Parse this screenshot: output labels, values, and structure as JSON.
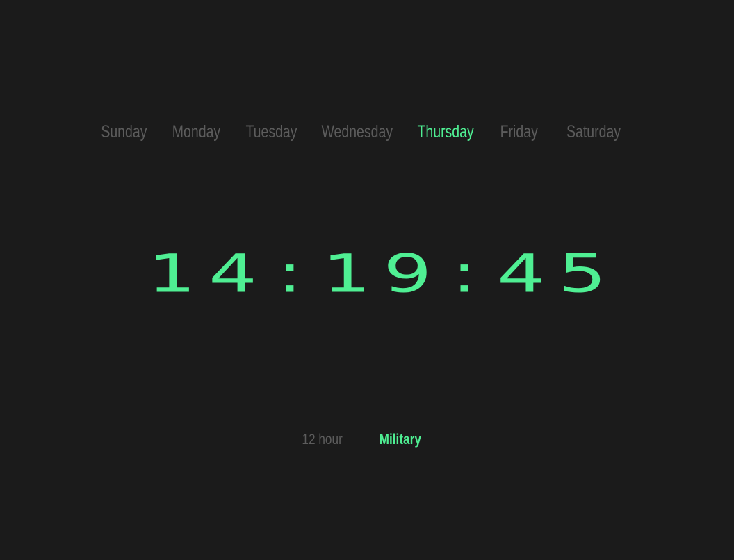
{
  "days": [
    {
      "label": "Sunday",
      "active": false
    },
    {
      "label": "Monday",
      "active": false
    },
    {
      "label": "Tuesday",
      "active": false
    },
    {
      "label": "Wednesday",
      "active": false
    },
    {
      "label": "Thursday",
      "active": true
    },
    {
      "label": "Friday",
      "active": false
    },
    {
      "label": "Saturday",
      "active": false
    }
  ],
  "clock": {
    "hours": "14",
    "minutes": "19",
    "seconds": "45",
    "separator": ":"
  },
  "modes": [
    {
      "label": "12 hour",
      "active": false
    },
    {
      "label": "Military",
      "active": true
    }
  ],
  "colors": {
    "background": "#1b1b1b",
    "accent": "#4fef93",
    "inactive": "#5c5c5c"
  }
}
